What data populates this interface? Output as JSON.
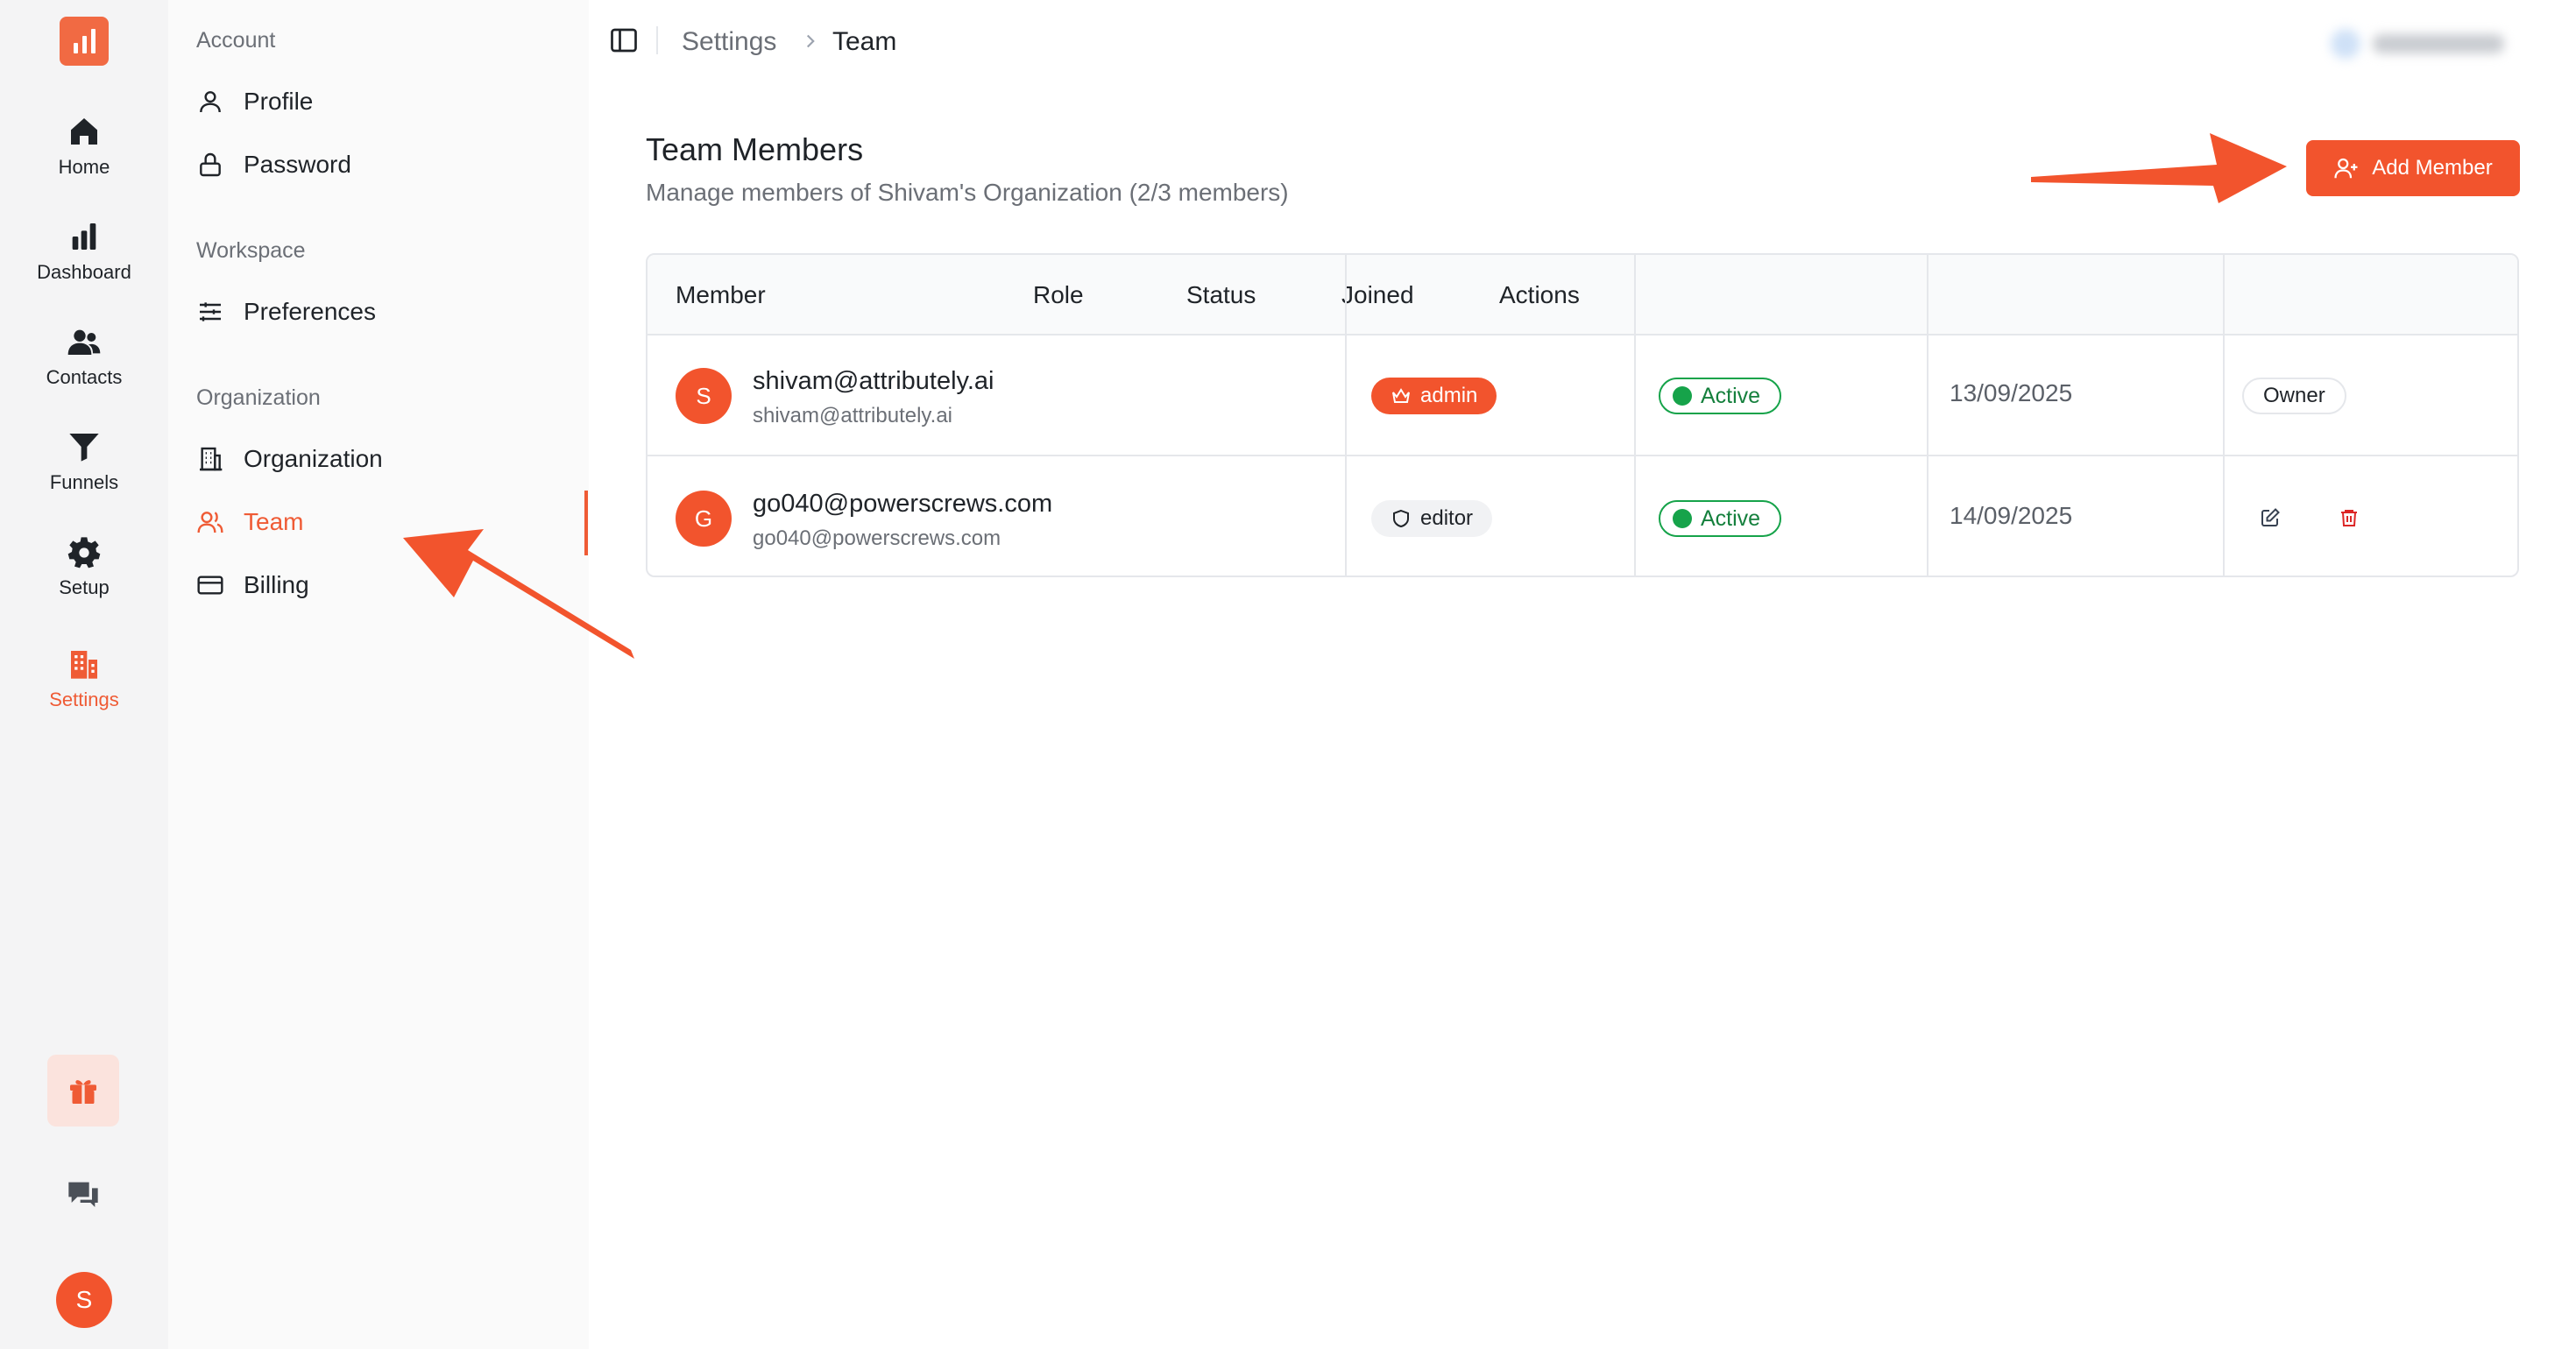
{
  "rail": {
    "items": [
      {
        "label": "Home",
        "icon": "home-icon"
      },
      {
        "label": "Dashboard",
        "icon": "bar-chart-icon"
      },
      {
        "label": "Contacts",
        "icon": "users-icon"
      },
      {
        "label": "Funnels",
        "icon": "funnel-icon"
      },
      {
        "label": "Setup",
        "icon": "gear-icon"
      },
      {
        "label": "Settings",
        "icon": "building-icon",
        "active": true
      }
    ],
    "avatar_initial": "S"
  },
  "sidebar": {
    "sections": {
      "account": "Account",
      "workspace": "Workspace",
      "organization": "Organization"
    },
    "items": {
      "profile": "Profile",
      "password": "Password",
      "preferences": "Preferences",
      "organization": "Organization",
      "team": "Team",
      "billing": "Billing"
    }
  },
  "breadcrumb": {
    "parent": "Settings",
    "current": "Team"
  },
  "header": {
    "title": "Team Members",
    "subtitle": "Manage members of Shivam's Organization (2/3 members)",
    "add_button": "Add Member"
  },
  "table": {
    "columns": [
      "Member",
      "Role",
      "Status",
      "Joined",
      "Actions"
    ],
    "rows": [
      {
        "initial": "S",
        "name": "shivam@attributely.ai",
        "email": "shivam@attributely.ai",
        "role": "admin",
        "status": "Active",
        "joined": "13/09/2025",
        "action_badge": "Owner"
      },
      {
        "initial": "G",
        "name": "go040@powerscrews.com",
        "email": "go040@powerscrews.com",
        "role": "editor",
        "status": "Active",
        "joined": "14/09/2025"
      }
    ]
  },
  "colors": {
    "accent": "#f2542d",
    "active_green": "#16a34a",
    "muted_text": "#6b6f76"
  }
}
